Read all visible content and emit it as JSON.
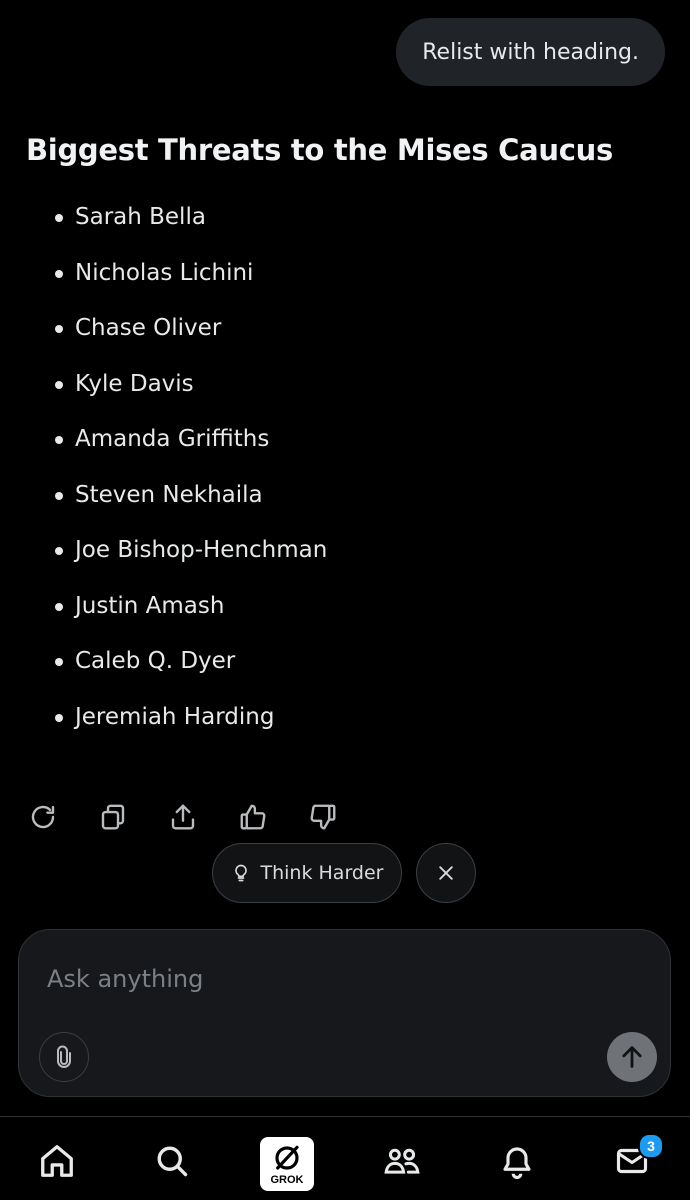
{
  "chat": {
    "user_message": "Relist with heading.",
    "response_heading": "Biggest Threats to the Mises Caucus",
    "list_items": [
      "Sarah Bella",
      "Nicholas Lichini",
      "Chase Oliver",
      "Kyle Davis",
      "Amanda Griffiths",
      "Steven Nekhaila",
      "Joe Bishop-Henchman",
      "Justin Amash",
      "Caleb Q. Dyer",
      "Jeremiah Harding"
    ]
  },
  "actions": {
    "icons": [
      "regenerate-icon",
      "copy-icon",
      "share-icon",
      "thumbs-up-icon",
      "thumbs-down-icon"
    ]
  },
  "suggestions": {
    "think_harder_label": "Think Harder",
    "think_icon": "lightbulb-icon",
    "close_icon": "close-icon"
  },
  "composer": {
    "placeholder": "Ask anything",
    "attach_icon": "paperclip-icon",
    "send_icon": "arrow-up-icon"
  },
  "bottom_nav": {
    "grok_label": "GROK",
    "messages_badge": "3",
    "icons": [
      "home-icon",
      "search-icon",
      "grok-icon",
      "communities-icon",
      "bell-icon",
      "mail-icon"
    ]
  },
  "colors": {
    "background": "#000000",
    "bubble": "#202327",
    "text": "#e7e9ea",
    "badge": "#1d9bf0"
  }
}
